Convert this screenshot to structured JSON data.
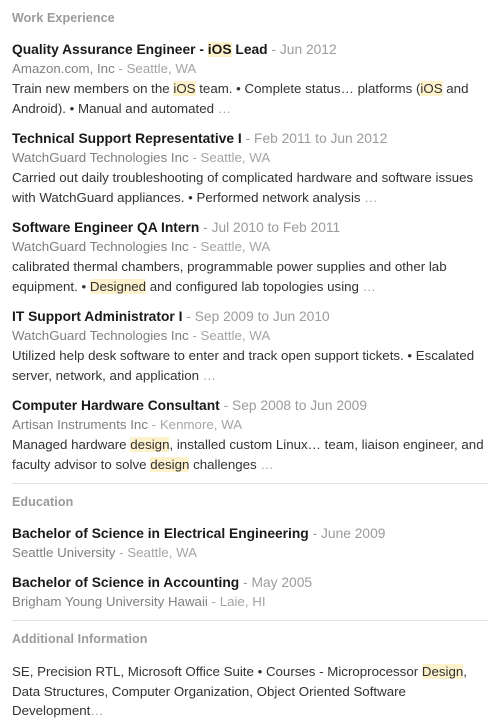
{
  "colors": {
    "highlight": "#fdf2cc",
    "section_header": "#9a9a9a",
    "title": "#1a1a1a",
    "date": "#9b9b9b",
    "organization": "#808080",
    "location": "#a5a5a5",
    "description": "#333333",
    "divider": "#e2e2e2"
  },
  "sections": {
    "work_experience": {
      "header": "Work Experience",
      "entries": [
        {
          "title_plain": "Quality Assurance Engineer - iOS Lead",
          "title_parts": [
            {
              "text": "Quality Assurance Engineer - ",
              "highlight": false
            },
            {
              "text": "iOS",
              "highlight": true
            },
            {
              "text": " Lead",
              "highlight": false
            }
          ],
          "dates": "Jun 2012",
          "organization": "Amazon.com, Inc",
          "location": "Seattle, WA",
          "description_plain": "Train new members on the iOS team. • Complete status… platforms (iOS and Android). • Manual and automated …",
          "description_parts": [
            {
              "text": "Train new members on the ",
              "highlight": false
            },
            {
              "text": "iOS",
              "highlight": true
            },
            {
              "text": " team. • Complete status… platforms (",
              "highlight": false
            },
            {
              "text": "iOS",
              "highlight": true
            },
            {
              "text": " and Android). • Manual and automated ",
              "highlight": false
            }
          ],
          "description_ellipsis": "…"
        },
        {
          "title_plain": "Technical Support Representative I",
          "title_parts": [
            {
              "text": "Technical Support Representative I",
              "highlight": false
            }
          ],
          "dates": "Feb 2011 to Jun 2012",
          "organization": "WatchGuard Technologies Inc",
          "location": "Seattle, WA",
          "description_plain": "Carried out daily troubleshooting of complicated hardware and software issues with WatchGuard appliances. • Performed network analysis …",
          "description_parts": [
            {
              "text": "Carried out daily troubleshooting of complicated hardware and software issues with WatchGuard appliances. • Performed network analysis ",
              "highlight": false
            }
          ],
          "description_ellipsis": "…"
        },
        {
          "title_plain": "Software Engineer QA Intern",
          "title_parts": [
            {
              "text": "Software Engineer QA Intern",
              "highlight": false
            }
          ],
          "dates": "Jul 2010 to Feb 2011",
          "organization": "WatchGuard Technologies Inc",
          "location": "Seattle, WA",
          "description_plain": "calibrated thermal chambers, programmable power supplies and other lab equipment. • Designed and configured lab topologies using …",
          "description_parts": [
            {
              "text": "calibrated thermal chambers, programmable power supplies and other lab equipment. • ",
              "highlight": false
            },
            {
              "text": "Designed",
              "highlight": true
            },
            {
              "text": " and configured lab topologies using ",
              "highlight": false
            }
          ],
          "description_ellipsis": "…"
        },
        {
          "title_plain": "IT Support Administrator I",
          "title_parts": [
            {
              "text": "IT Support Administrator I",
              "highlight": false
            }
          ],
          "dates": "Sep 2009 to Jun 2010",
          "organization": "WatchGuard Technologies Inc",
          "location": "Seattle, WA",
          "description_plain": "Utilized help desk software to enter and track open support tickets. • Escalated server, network, and application …",
          "description_parts": [
            {
              "text": "Utilized help desk software to enter and track open support tickets. • Escalated server, network, and application ",
              "highlight": false
            }
          ],
          "description_ellipsis": "…"
        },
        {
          "title_plain": "Computer Hardware Consultant",
          "title_parts": [
            {
              "text": "Computer Hardware Consultant",
              "highlight": false
            }
          ],
          "dates": "Sep 2008 to Jun 2009",
          "organization": "Artisan Instruments Inc",
          "location": "Kenmore, WA",
          "description_plain": "Managed hardware design, installed custom Linux… team, liaison engineer, and faculty advisor to solve design challenges …",
          "description_parts": [
            {
              "text": "Managed hardware ",
              "highlight": false
            },
            {
              "text": "design",
              "highlight": true
            },
            {
              "text": ", installed custom Linux… team, liaison engineer, and faculty advisor to solve ",
              "highlight": false
            },
            {
              "text": "design",
              "highlight": true
            },
            {
              "text": " challenges ",
              "highlight": false
            }
          ],
          "description_ellipsis": "…"
        }
      ]
    },
    "education": {
      "header": "Education",
      "entries": [
        {
          "title_plain": "Bachelor of Science in Electrical Engineering",
          "title_parts": [
            {
              "text": "Bachelor of Science in Electrical Engineering",
              "highlight": false
            }
          ],
          "dates": "June 2009",
          "organization": "Seattle University",
          "location": "Seattle, WA"
        },
        {
          "title_plain": "Bachelor of Science in Accounting",
          "title_parts": [
            {
              "text": "Bachelor of Science in Accounting",
              "highlight": false
            }
          ],
          "dates": "May 2005",
          "organization": "Brigham Young University Hawaii",
          "location": "Laie, HI"
        }
      ]
    },
    "additional_information": {
      "header": "Additional Information",
      "body_plain": "SE, Precision RTL, Microsoft Office Suite • Courses - Microprocessor Design, Data Structures, Computer Organization, Object Oriented Software Development…",
      "body_parts": [
        {
          "text": "SE, Precision RTL, Microsoft Office Suite • Courses - Microprocessor ",
          "highlight": false
        },
        {
          "text": "Design",
          "highlight": true
        },
        {
          "text": ", Data Structures, Computer Organization, Object Oriented Software Development",
          "highlight": false
        }
      ],
      "body_ellipsis": "…"
    }
  },
  "separator": " - "
}
